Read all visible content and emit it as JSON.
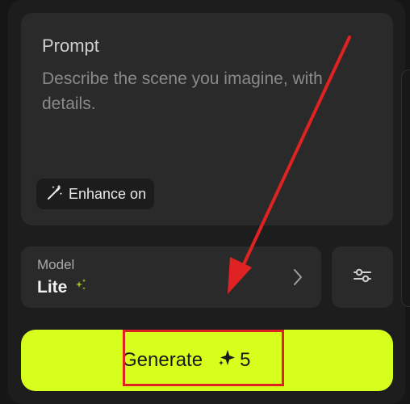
{
  "prompt": {
    "title": "Prompt",
    "placeholder": "Describe the scene you imagine, with details.",
    "value": "",
    "enhance_label": "Enhance on",
    "enhance_icon": "magic-wand-icon"
  },
  "model": {
    "label": "Model",
    "value": "Lite",
    "badge_icon": "sparkle-icon",
    "chevron_icon": "chevron-right-icon"
  },
  "settings": {
    "icon": "sliders-icon"
  },
  "generate": {
    "label": "Generate",
    "credit_icon": "sparkle-icon",
    "credits": "5"
  },
  "colors": {
    "accent": "#d7ff1e",
    "annotation": "#e02222",
    "badge": "#a6c21a"
  }
}
